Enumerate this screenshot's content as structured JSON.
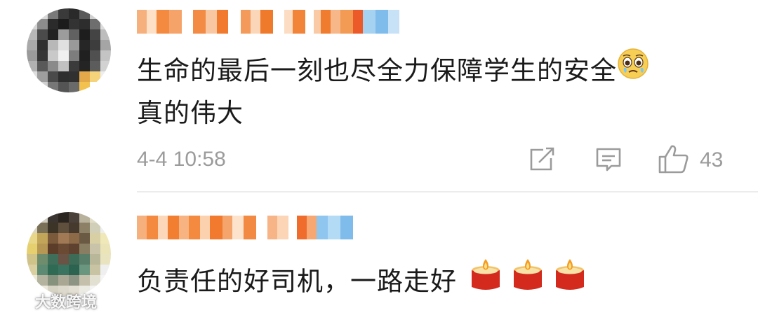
{
  "comments": [
    {
      "text_line1": "生命的最后一刻也尽全力保障学生的安全",
      "emoji1": "pleading-face-emoji",
      "text_line2": "真的伟大",
      "timestamp": "4-4 10:58",
      "like_count": "43"
    },
    {
      "text": "负责任的好司机，一路走好",
      "emoji": "candle-emoji"
    }
  ],
  "icons": {
    "share": "share-icon",
    "reply": "comment-icon",
    "like": "thumbs-up-icon"
  },
  "colors": {
    "timestamp": "#9b9b9b",
    "icon": "#9b9b9b",
    "mosaic_orange": "#f4893d",
    "mosaic_blue": "#8ec6ef"
  },
  "watermark": {
    "text": "大数跨境"
  }
}
